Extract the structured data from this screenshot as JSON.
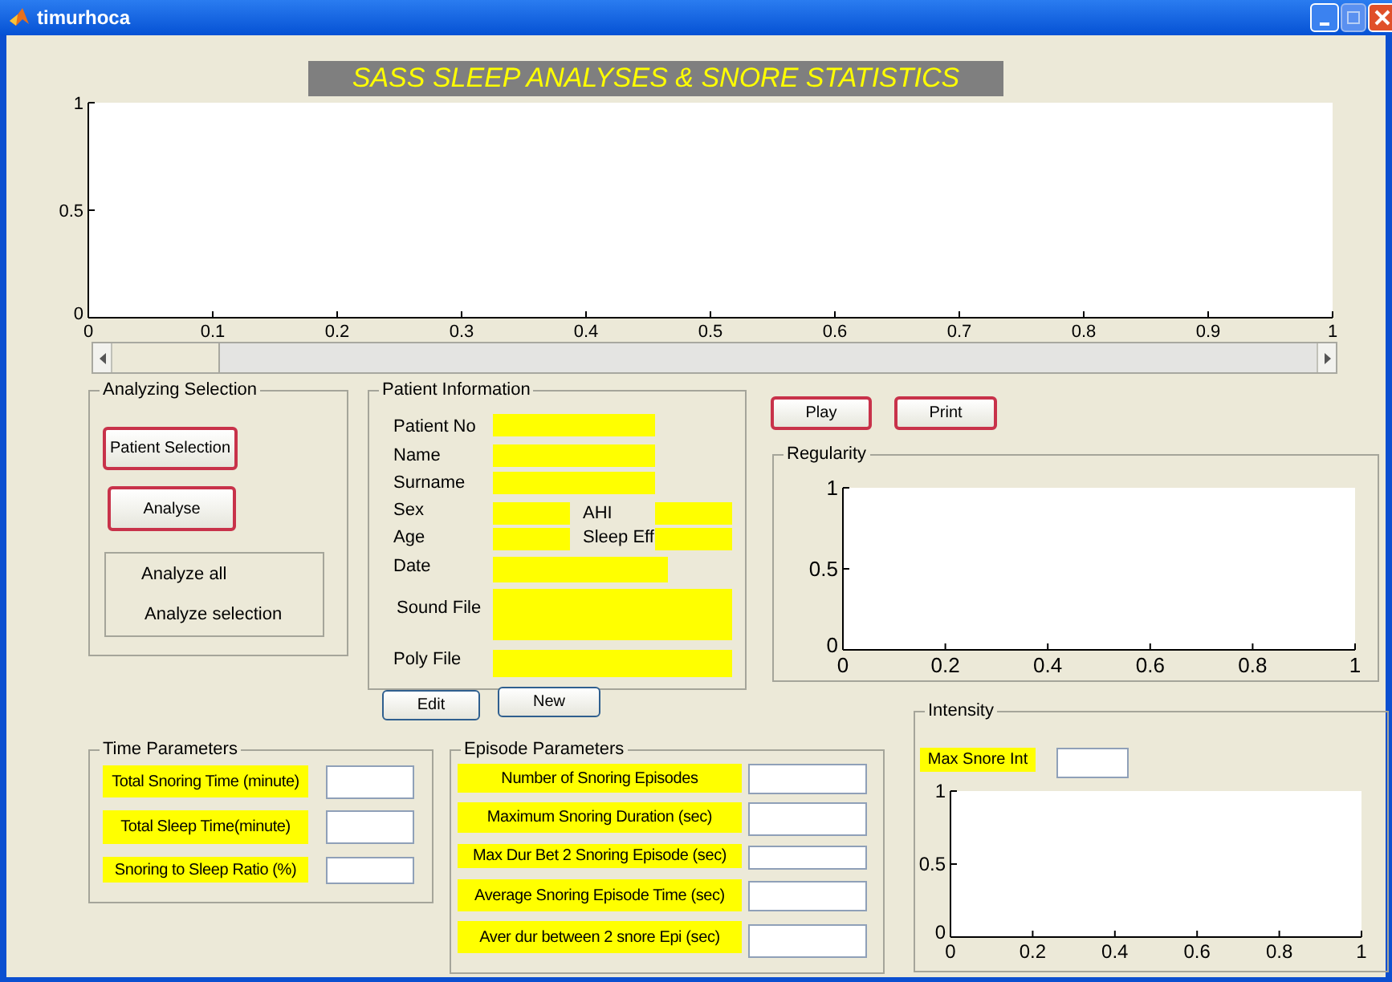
{
  "window": {
    "title": "timurhoca"
  },
  "banner": "SASS SLEEP ANALYSES & SNORE STATISTICS",
  "main_plot": {
    "chart_data": {
      "type": "line",
      "xlim": [
        0,
        1
      ],
      "ylim": [
        0,
        1
      ],
      "xticks": [
        0,
        0.1,
        0.2,
        0.3,
        0.4,
        0.5,
        0.6,
        0.7,
        0.8,
        0.9,
        1
      ],
      "yticks": [
        0,
        0.5,
        1
      ]
    }
  },
  "slider": {
    "level": 0
  },
  "analyzing_selection": {
    "title": "Analyzing Selection",
    "buttons": [
      {
        "label": "Patient Selection",
        "highlighted": true
      },
      {
        "label": "Analyse",
        "highlighted": true
      }
    ],
    "options": [
      "Analyze all",
      "Analyze selection"
    ]
  },
  "patient_information": {
    "title": "Patient Information",
    "fields": [
      "Patient No",
      "Name",
      "Surname",
      "Sex",
      "AHI",
      "Age",
      "Sleep Eff",
      "Date",
      "Sound File",
      "Poly File"
    ],
    "buttons": [
      {
        "label": "Edit",
        "highlighted": false
      },
      {
        "label": "New",
        "highlighted": false
      }
    ]
  },
  "actions": [
    {
      "label": "Play",
      "highlighted": true
    },
    {
      "label": "Print",
      "highlighted": true
    }
  ],
  "regularity": {
    "title": "Regularity",
    "chart_data": {
      "type": "line",
      "xlim": [
        0,
        1
      ],
      "ylim": [
        0,
        1
      ],
      "xticks": [
        0,
        0.2,
        0.4,
        0.6,
        0.8,
        1
      ],
      "yticks": [
        0,
        0.5,
        1
      ]
    }
  },
  "time_parameters": {
    "title": "Time Parameters",
    "fields": [
      "Total Snoring Time (minute)",
      "Total Sleep Time(minute)",
      "Snoring to Sleep Ratio (%)"
    ]
  },
  "episode_parameters": {
    "title": "Episode Parameters",
    "fields": [
      "Number of Snoring Episodes",
      "Maximum Snoring Duration  (sec)",
      "Max Dur Bet 2 Snoring Episode (sec)",
      "Average Snoring Episode Time (sec)",
      "Aver dur between 2 snore Epi (sec)"
    ]
  },
  "intensity": {
    "title": "Intensity",
    "field": "Max Snore Int",
    "chart_data": {
      "type": "line",
      "xlim": [
        0,
        1
      ],
      "ylim": [
        0,
        1
      ],
      "xticks": [
        0,
        0.2,
        0.4,
        0.6,
        0.8,
        1
      ],
      "yticks": [
        0,
        0.5,
        1
      ]
    }
  }
}
